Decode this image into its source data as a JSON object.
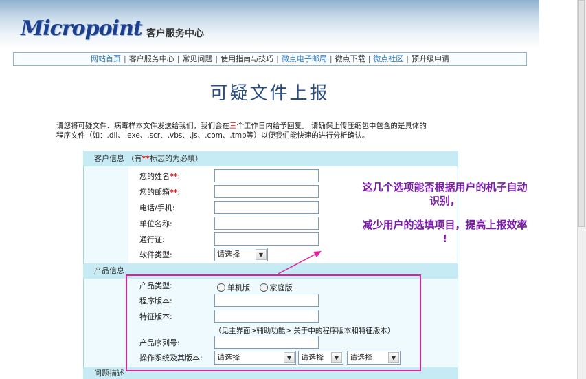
{
  "header": {
    "logo_text": "Micropoint",
    "subtitle": "客户服务中心"
  },
  "nav": [
    {
      "label": "网站首页",
      "highlight": true
    },
    {
      "label": "客户服务中心",
      "highlight": false
    },
    {
      "label": "常见问题",
      "highlight": false
    },
    {
      "label": "使用指南与技巧",
      "highlight": false
    },
    {
      "label": "微点电子邮局",
      "highlight": true
    },
    {
      "label": "微点下载",
      "highlight": false
    },
    {
      "label": "微点社区",
      "highlight": true
    },
    {
      "label": "预升级申请",
      "highlight": false
    }
  ],
  "nav_separator": "|",
  "page_title": "可疑文件上报",
  "intro": {
    "part1": "请您将可疑文件、病毒样本文件发送给我们，我们会在",
    "days": "三",
    "part2": "个工作日内给予回复。 请确保上传压缩包中包含的是具体的",
    "line2": "程序文件（如：.dll、.exe、.scr、.vbs、.js、.com、.tmp等）以便我们能快速的进行分析确认。"
  },
  "customer_section": {
    "title": "客户信息",
    "note_open": "（有",
    "note_mark": "**",
    "note_close": "标志的为必填）",
    "fields": {
      "name": "您的姓名",
      "email": "您的邮箱",
      "phone": "电话/手机:",
      "company": "单位名称:",
      "pass": "通行证:",
      "software": "软件类型:"
    },
    "req_mark": "**",
    "colon": ":",
    "software_select": "请选择"
  },
  "product_section": {
    "title": "产品信息",
    "type_label": "产品类型:",
    "radio_options": [
      "单机版",
      "家庭版"
    ],
    "version_label": "程序版本:",
    "sig_label": "特征版本:",
    "hint": "（见主界面>辅助功能> 关于中的程序版本和特征版本）",
    "serial_label": "产品序列号:",
    "os_label": "操作系统及其版本:",
    "os_selects": [
      "请选择",
      "请选择",
      "请选择"
    ]
  },
  "problem_section": {
    "title": "问题描述"
  },
  "annotation": {
    "line1": "这几个选项能否根据用户的机子自动",
    "line2": "识别，",
    "line3": "减少用户的选填项目，提高上报效率",
    "line4": "!"
  },
  "colors": {
    "annotation_box": "#e0209a",
    "annotation_text": "#7a1ca8",
    "required_mark": "#dd0000",
    "section_header": "#c6ebf4",
    "nav_link": "#2a77b8"
  },
  "icons": {
    "select_arrow": "chevron-down-icon",
    "radio": "radio-icon"
  }
}
